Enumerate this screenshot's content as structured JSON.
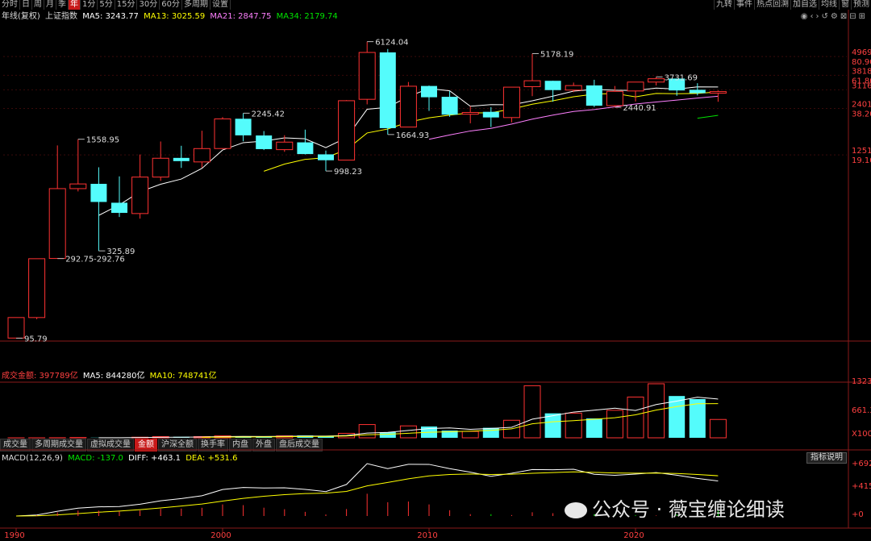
{
  "toolbar": {
    "items": [
      "分时",
      "日",
      "周",
      "月",
      "季",
      "年",
      "1分",
      "5分",
      "15分",
      "30分",
      "60分",
      "多周期",
      "设置"
    ],
    "active_index": 5,
    "right_items": [
      "九转",
      "事件",
      "热点回溯",
      "加自选",
      "均线",
      "窗",
      "预测"
    ]
  },
  "main_legend": {
    "title": "年线(复权)",
    "index": "上证指数",
    "ma5": "MA5: 3243.77",
    "ma13": "MA13: 3025.59",
    "ma21": "MA21: 2847.75",
    "ma34": "MA34: 2179.74"
  },
  "volume_legend": {
    "title": "成交金额: 397789亿",
    "ma5": "MA5: 844280亿",
    "ma10": "MA10: 748741亿"
  },
  "macd_legend": {
    "title": "MACD(12,26,9)",
    "macd": "MACD: -137.0",
    "diff": "DIFF: +463.1",
    "dea": "DEA: +531.6"
  },
  "tabs": {
    "items": [
      "成交量",
      "多周期成交量",
      "虚拟成交量",
      "金额",
      "沪深全额",
      "换手率",
      "内盘",
      "外盘",
      "盘后成交量"
    ],
    "active_index": 3
  },
  "explain_button": "指标说明",
  "watermark": "公众号 · 薇宝缠论细读",
  "colors": {
    "up": "#ff3232",
    "down": "#54fcfc",
    "ma5": "#ffffff",
    "ma13": "#ffff00",
    "ma21": "#ff80ff",
    "ma34": "#00e600"
  },
  "chart_data": {
    "type": "candlestick",
    "period": "yearly",
    "years": [
      1990,
      1991,
      1992,
      1993,
      1994,
      1995,
      1996,
      1997,
      1998,
      1999,
      2000,
      2001,
      2002,
      2003,
      2004,
      2005,
      2006,
      2007,
      2008,
      2009,
      2010,
      2011,
      2012,
      2013,
      2014,
      2015,
      2016,
      2017,
      2018,
      2019,
      2020,
      2021,
      2022,
      2023,
      2024
    ],
    "ohlc": [
      [
        96,
        128,
        95.79,
        128
      ],
      [
        128,
        292,
        125,
        292
      ],
      [
        293,
        1429,
        292.75,
        780
      ],
      [
        780,
        1558.95,
        750,
        833
      ],
      [
        834,
        1052,
        325.89,
        647
      ],
      [
        640,
        926,
        524,
        555
      ],
      [
        550,
        1258,
        512,
        917
      ],
      [
        917,
        1510,
        870,
        1194
      ],
      [
        1200,
        1422,
        1043,
        1147
      ],
      [
        1134,
        1756,
        1047,
        1367
      ],
      [
        1368,
        2125,
        1361,
        2073
      ],
      [
        2077,
        2245.42,
        1514,
        1646
      ],
      [
        1643,
        1748,
        1339,
        1357
      ],
      [
        1347,
        1649,
        1307,
        1497
      ],
      [
        1492,
        1783,
        1259,
        1266
      ],
      [
        1261,
        1329,
        998.23,
        1161
      ],
      [
        1163,
        2698,
        1161,
        2675
      ],
      [
        2728,
        6124.04,
        2541,
        5262
      ],
      [
        5265,
        5522,
        1664.93,
        1821
      ],
      [
        1849,
        3478,
        1844,
        3277
      ],
      [
        3289,
        3306,
        2319,
        2808
      ],
      [
        2825,
        3067,
        2134,
        2199
      ],
      [
        2213,
        2478,
        1949,
        2269
      ],
      [
        2289,
        2444,
        1849,
        2116
      ],
      [
        2112,
        3239,
        1974,
        3235
      ],
      [
        3258,
        5178.19,
        2850,
        3539
      ],
      [
        3536,
        3539,
        2638,
        3104
      ],
      [
        3105,
        3450,
        3016,
        3307
      ],
      [
        3314,
        3587,
        2449,
        2494
      ],
      [
        2497,
        3288,
        2440.91,
        3050
      ],
      [
        3066,
        3474,
        2646,
        3473
      ],
      [
        3474,
        3731.69,
        3312,
        3640
      ],
      [
        3649,
        3652,
        2863,
        3089
      ],
      [
        3117,
        3419,
        2882,
        2975
      ],
      [
        2972,
        3087,
        2635,
        3040
      ]
    ],
    "price_axis": [
      {
        "value": "4969",
        "pct": "80.90%"
      },
      {
        "value": "3818",
        "pct": "61.80%"
      },
      {
        "value": "3116",
        "pct": ""
      },
      {
        "value": "2401",
        "pct": "38.20%"
      },
      {
        "value": "1251",
        "pct": "19.10%"
      }
    ],
    "extrema_labels": [
      "6124.04",
      "5178.19",
      "3731.69",
      "2245.42",
      "1558.95",
      "2440.91",
      "1664.93",
      "998.23",
      "325.89",
      "292.75-292.76",
      "95.79"
    ],
    "volume_axis": [
      "1323",
      "661.3",
      "X1000"
    ],
    "macd_axis": [
      "+692.7",
      "+415.6",
      "+0"
    ],
    "year_axis": [
      "1990",
      "2000",
      "2010",
      "2020"
    ]
  }
}
